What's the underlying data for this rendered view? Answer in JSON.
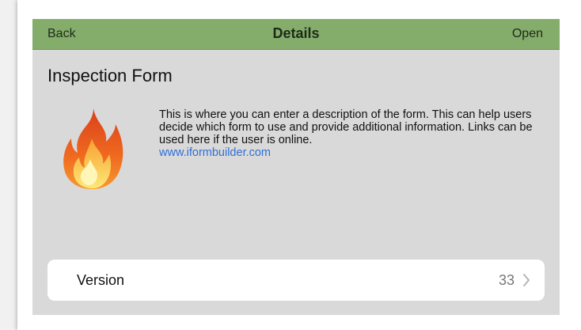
{
  "navbar": {
    "back_label": "Back",
    "title": "Details",
    "open_label": "Open",
    "color": "#84ad6b"
  },
  "form": {
    "title": "Inspection Form",
    "icon": "fire-icon",
    "description": "This is where you can enter a description of the form.  This can help users decide which form to use and provide additional information. Links can be used here if the user is online.",
    "link_text": "www.iformbuilder.com",
    "link_color": "#2f6fd6"
  },
  "version": {
    "label": "Version",
    "value": "33",
    "icon": "chevron-right-icon"
  },
  "colors": {
    "content_background": "#d9d9d9"
  }
}
